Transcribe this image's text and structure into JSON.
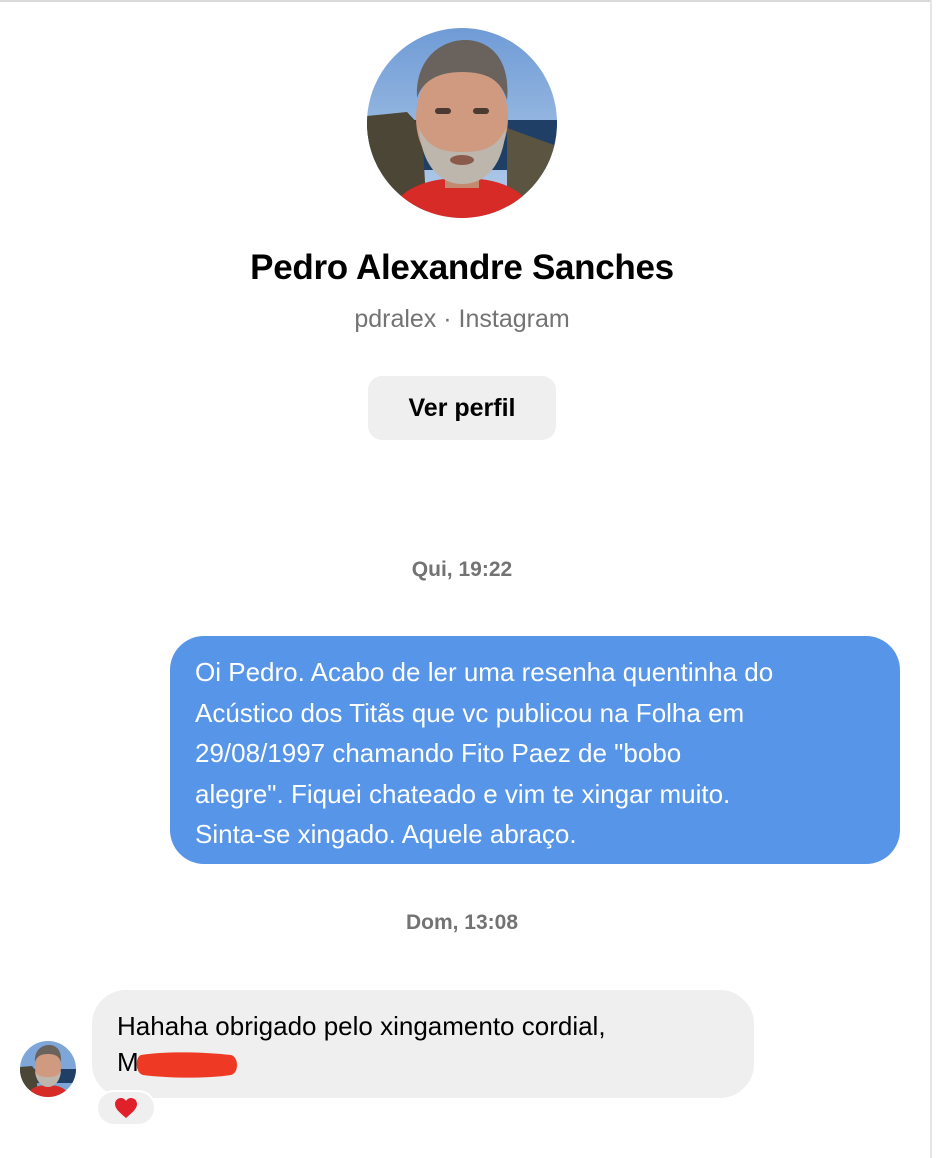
{
  "profile": {
    "name": "Pedro Alexandre Sanches",
    "subtitle": "pdralex · Instagram",
    "view_profile_label": "Ver perfil",
    "avatar_icon": "profile-photo"
  },
  "messages": [
    {
      "timestamp": "Qui, 19:22",
      "direction": "outgoing",
      "lines": [
        "Oi Pedro. Acabo de ler uma resenha quentinha do",
        "Acústico dos Titãs que vc publicou na Folha em",
        "29/08/1997 chamando Fito Paez de \"bobo",
        "alegre\". Fiquei chateado e vim te xingar muito.",
        "Sinta-se xingado. Aquele abraço."
      ]
    },
    {
      "timestamp": "Dom, 13:08",
      "direction": "incoming",
      "lines": [
        "Hahaha obrigado pelo xingamento cordial,",
        "M"
      ],
      "reaction_icon": "heart-icon"
    }
  ],
  "colors": {
    "outgoing_bubble": "#5795e8",
    "incoming_bubble": "#efefef",
    "muted_text": "#737373",
    "redaction": "#ee3a24",
    "heart": "#e0202b"
  }
}
